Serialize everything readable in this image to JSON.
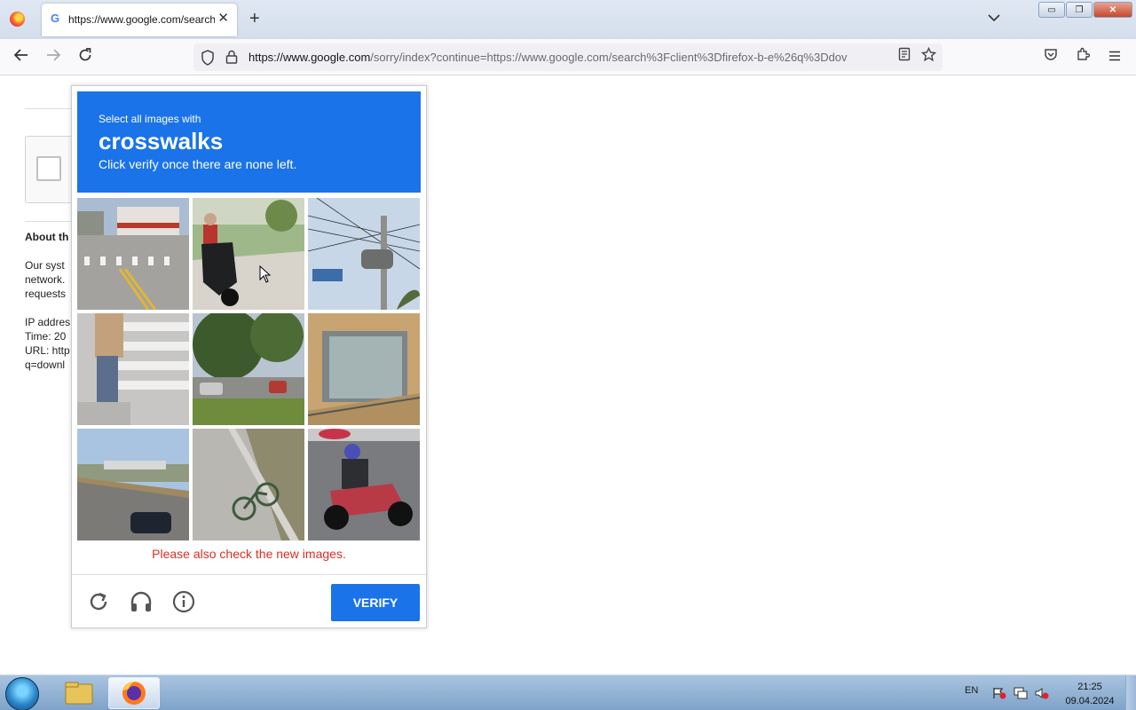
{
  "browser": {
    "tab_title": "https://www.google.com/search",
    "tab_close": "✕",
    "new_tab": "+",
    "url_host": "https://www.google.com",
    "url_path": "/sorry/index?continue=https://www.google.com/search%3Fclient%3Dfirefox-b-e%26q%3Ddov",
    "window_buttons": {
      "minimize": "▭",
      "restore": "❐",
      "close": "✕"
    }
  },
  "page": {
    "about_heading": "About th",
    "lines": [
      "Our syst",
      "network.",
      "requests"
    ],
    "meta_lines": [
      "IP addres",
      "Time: 20",
      "URL: http",
      "q=downl"
    ]
  },
  "captcha": {
    "instruction_small": "Select all images with",
    "instruction_big": "crosswalks",
    "instruction_sub": "Click verify once there are none left.",
    "error_message": "Please also check the new images.",
    "verify_label": "VERIFY",
    "tiles": [
      "crosswalk-street",
      "scooter-rider",
      "utility-pole",
      "person-on-crosswalk",
      "trees-parking",
      "signboard",
      "overpass-car",
      "bicycle-on-sidewalk",
      "motorcycle-rider"
    ]
  },
  "taskbar": {
    "lang": "EN",
    "time": "21:25",
    "date": "09.04.2024"
  },
  "colors": {
    "captcha_blue": "#1a73e8",
    "error_red": "#d93025"
  }
}
